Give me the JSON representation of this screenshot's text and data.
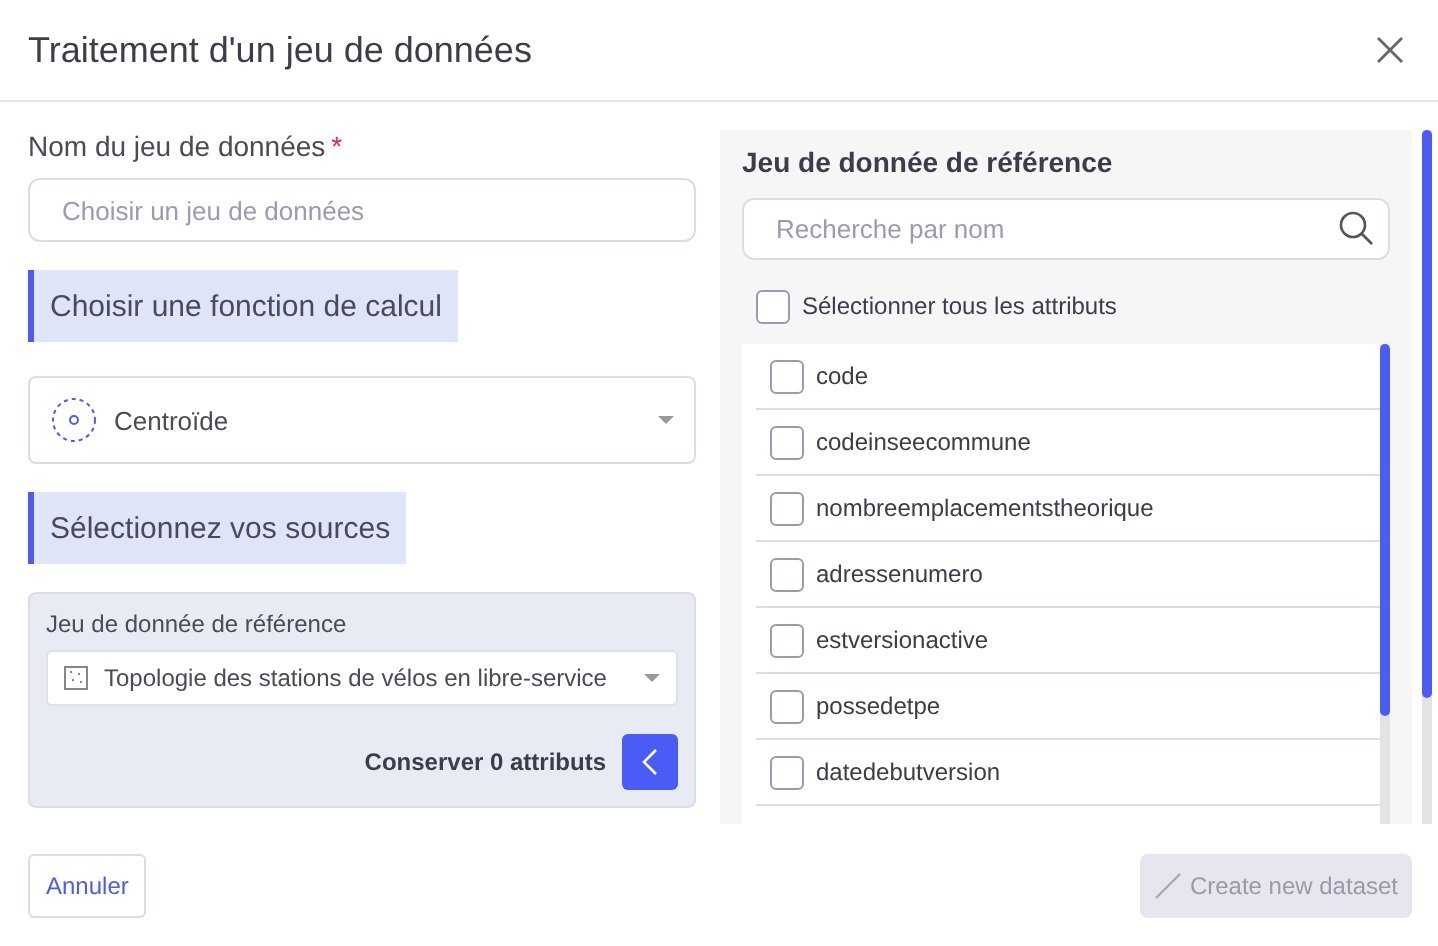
{
  "window": {
    "title": "Traitement d'un jeu de données"
  },
  "dataset_name": {
    "label": "Nom du jeu de données",
    "required_mark": "*",
    "placeholder": "Choisir un jeu de données"
  },
  "function_section": {
    "title": "Choisir une fonction de calcul",
    "value": "Centroïde"
  },
  "sources_section": {
    "title": "Sélectionnez vos sources",
    "source_label": "Jeu de donnée de référence",
    "source_value": "Topologie des stations de vélos en libre-service",
    "keep_label": "Conserver 0 attributs"
  },
  "attributes_panel": {
    "title": "Jeu de donnée de référence",
    "search_placeholder": "Recherche par nom",
    "select_all": {
      "label": "Sélectionner tous les attributs",
      "checked": false
    },
    "items": [
      {
        "label": "code",
        "checked": false
      },
      {
        "label": "codeinseecommune",
        "checked": false
      },
      {
        "label": "nombreemplacementstheorique",
        "checked": false
      },
      {
        "label": "adressenumero",
        "checked": false
      },
      {
        "label": "estversionactive",
        "checked": false
      },
      {
        "label": "possedetpe",
        "checked": false
      },
      {
        "label": "datedebutversion",
        "checked": false
      }
    ]
  },
  "buttons": {
    "cancel": "Annuler",
    "create": {
      "label": "Create new dataset",
      "disabled": true
    }
  }
}
